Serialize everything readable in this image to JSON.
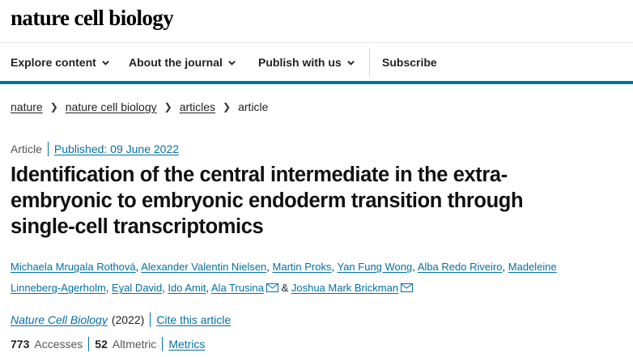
{
  "brand": {
    "logo_text": "nature cell biology"
  },
  "nav": {
    "items": [
      {
        "label": "Explore content",
        "has_dropdown": true
      },
      {
        "label": "About the journal",
        "has_dropdown": true
      },
      {
        "label": "Publish with us",
        "has_dropdown": true
      },
      {
        "label": "Subscribe",
        "has_dropdown": false
      }
    ]
  },
  "breadcrumb": [
    "nature",
    "nature cell biology",
    "articles",
    "article"
  ],
  "article": {
    "type": "Article",
    "published": "Published: 09 June 2022",
    "title": "Identification of the central intermediate in the extra-embryonic to embryonic endoderm transition through single-cell transcriptomics",
    "authors": [
      "Michaela Mrugala Rothová",
      "Alexander Valentin Nielsen",
      "Martin Proks",
      "Yan Fung Wong",
      "Alba Redo Riveiro",
      "Madeleine Linneberg-Agerholm",
      "Eyal David",
      "Ido Amit",
      "Ala Trusina",
      "Joshua Mark Brickman"
    ],
    "author_conjunction": "&",
    "journal": "Nature Cell Biology",
    "year": "(2022)",
    "cite_link": "Cite this article",
    "accesses_count": "773",
    "accesses_label": "Accesses",
    "altmetric_count": "52",
    "altmetric_label": "Altmetric",
    "metrics_link": "Metrics"
  },
  "colors": {
    "accent": "#0070a8",
    "text": "#222222"
  }
}
